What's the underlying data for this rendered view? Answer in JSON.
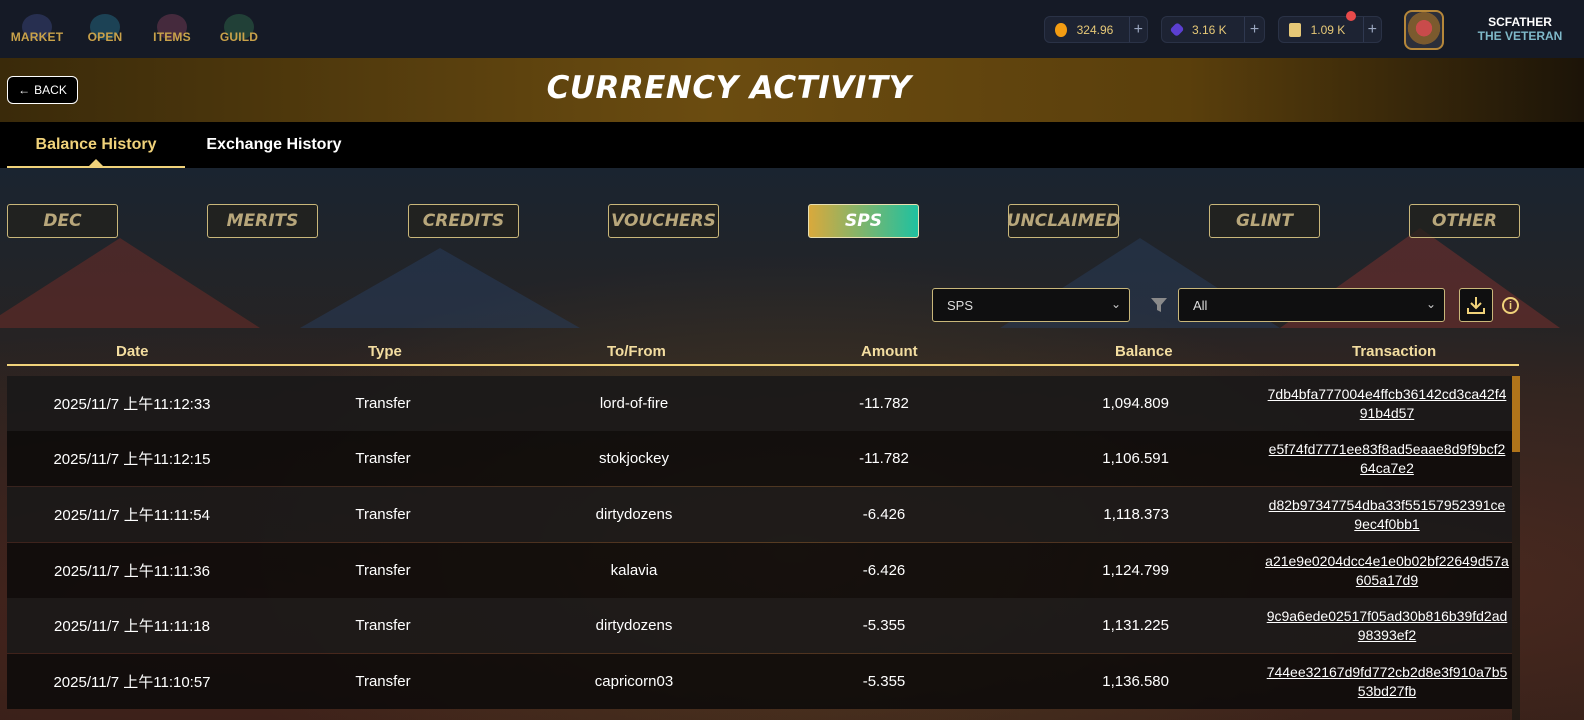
{
  "nav": {
    "items": [
      {
        "label": "MARKET",
        "icon": "market-icon"
      },
      {
        "label": "OPEN",
        "icon": "open-packs-icon"
      },
      {
        "label": "ITEMS",
        "icon": "items-icon"
      },
      {
        "label": "GUILD",
        "icon": "guild-icon"
      }
    ]
  },
  "balances": [
    {
      "value": "324.96",
      "icon": "dec-coin-icon",
      "color": "#f39c12"
    },
    {
      "value": "3.16 K",
      "icon": "gem-icon",
      "color": "#5b3fd1"
    },
    {
      "value": "1.09 K",
      "icon": "voucher-icon",
      "color": "#e6c877"
    }
  ],
  "user": {
    "name": "SCFATHER",
    "title": "THE VETERAN"
  },
  "header": {
    "back_label": "BACK",
    "title": "CURRENCY ACTIVITY"
  },
  "tabs": [
    {
      "label": "Balance History",
      "active": true
    },
    {
      "label": "Exchange History",
      "active": false
    }
  ],
  "categories": [
    {
      "label": "DEC",
      "active": false
    },
    {
      "label": "MERITS",
      "active": false
    },
    {
      "label": "CREDITS",
      "active": false
    },
    {
      "label": "VOUCHERS",
      "active": false
    },
    {
      "label": "SPS",
      "active": true
    },
    {
      "label": "UNCLAIMED",
      "active": false
    },
    {
      "label": "GLINT",
      "active": false
    },
    {
      "label": "OTHER",
      "active": false
    }
  ],
  "filters": {
    "token_select": "SPS",
    "type_select": "All"
  },
  "table": {
    "columns": [
      "Date",
      "Type",
      "To/From",
      "Amount",
      "Balance",
      "Transaction"
    ],
    "rows": [
      {
        "date": "2025/11/7 上午11:12:33",
        "type": "Transfer",
        "to_from": "lord-of-fire",
        "amount": "-11.782",
        "balance": "1,094.809",
        "tx": "7db4bfa777004e4ffcb36142cd3ca42f491b4d57"
      },
      {
        "date": "2025/11/7 上午11:12:15",
        "type": "Transfer",
        "to_from": "stokjockey",
        "amount": "-11.782",
        "balance": "1,106.591",
        "tx": "e5f74fd7771ee83f8ad5eaae8d9f9bcf264ca7e2"
      },
      {
        "date": "2025/11/7 上午11:11:54",
        "type": "Transfer",
        "to_from": "dirtydozens",
        "amount": "-6.426",
        "balance": "1,118.373",
        "tx": "d82b97347754dba33f55157952391ce9ec4f0bb1"
      },
      {
        "date": "2025/11/7 上午11:11:36",
        "type": "Transfer",
        "to_from": "kalavia",
        "amount": "-6.426",
        "balance": "1,124.799",
        "tx": "a21e9e0204dcc4e1e0b02bf22649d57a605a17d9"
      },
      {
        "date": "2025/11/7 上午11:11:18",
        "type": "Transfer",
        "to_from": "dirtydozens",
        "amount": "-5.355",
        "balance": "1,131.225",
        "tx": "9c9a6ede02517f05ad30b816b39fd2ad98393ef2"
      },
      {
        "date": "2025/11/7 上午11:10:57",
        "type": "Transfer",
        "to_from": "capricorn03",
        "amount": "-5.355",
        "balance": "1,136.580",
        "tx": "744ee32167d9fd772cb2d8e3f910a7b553bd27fb"
      }
    ]
  },
  "colors": {
    "accent": "#f0d27a",
    "active_gradient_start": "#d9a93c",
    "active_gradient_end": "#1fc1a0"
  }
}
